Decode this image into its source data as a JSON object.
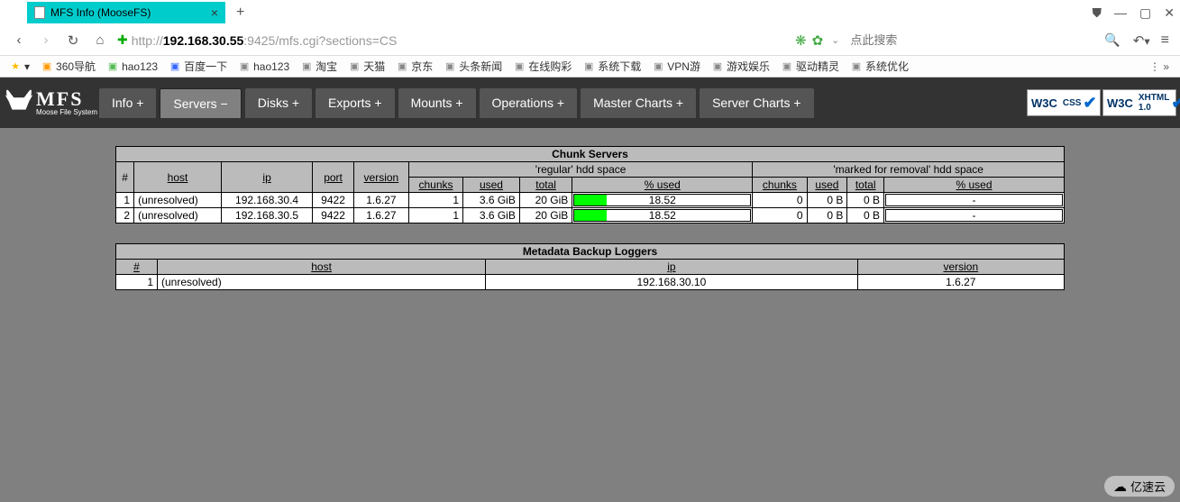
{
  "browser": {
    "tab_title": "MFS Info (MooseFS)",
    "url_prefix": "http://",
    "url_host": "192.168.30.55",
    "url_rest": ":9425/mfs.cgi?sections=CS",
    "search_placeholder": "点此搜索"
  },
  "bookmarks": [
    {
      "label": "360导航",
      "color": "#f90"
    },
    {
      "label": "hao123",
      "color": "#5b5"
    },
    {
      "label": "百度一下",
      "color": "#36f"
    },
    {
      "label": "hao123",
      "color": "#888"
    },
    {
      "label": "淘宝",
      "color": "#888"
    },
    {
      "label": "天猫",
      "color": "#888"
    },
    {
      "label": "京东",
      "color": "#888"
    },
    {
      "label": "头条新闻",
      "color": "#888"
    },
    {
      "label": "在线购彩",
      "color": "#888"
    },
    {
      "label": "系统下载",
      "color": "#888"
    },
    {
      "label": "VPN游",
      "color": "#888"
    },
    {
      "label": "游戏娱乐",
      "color": "#888"
    },
    {
      "label": "驱动精灵",
      "color": "#888"
    },
    {
      "label": "系统优化",
      "color": "#888"
    }
  ],
  "logo": {
    "main": "MFS",
    "sub": "Moose File System"
  },
  "nav": [
    {
      "label": "Info +",
      "active": false
    },
    {
      "label": "Servers −",
      "active": true
    },
    {
      "label": "Disks +",
      "active": false
    },
    {
      "label": "Exports +",
      "active": false
    },
    {
      "label": "Mounts +",
      "active": false
    },
    {
      "label": "Operations +",
      "active": false
    },
    {
      "label": "Master Charts +",
      "active": false
    },
    {
      "label": "Server Charts +",
      "active": false
    }
  ],
  "chunk": {
    "title": "Chunk Servers",
    "group_reg": "'regular' hdd space",
    "group_mfr": "'marked for removal' hdd space",
    "cols": {
      "num": "#",
      "host": "host",
      "ip": "ip",
      "port": "port",
      "version": "version",
      "chunks": "chunks",
      "used": "used",
      "total": "total",
      "pused": "% used"
    },
    "rows": [
      {
        "num": "1",
        "host": "(unresolved)",
        "ip": "192.168.30.4",
        "port": "9422",
        "version": "1.6.27",
        "r_chunks": "1",
        "r_used": "3.6 GiB",
        "r_total": "20 GiB",
        "r_pused": "18.52",
        "m_chunks": "0",
        "m_used": "0 B",
        "m_total": "0 B",
        "m_pused": "-"
      },
      {
        "num": "2",
        "host": "(unresolved)",
        "ip": "192.168.30.5",
        "port": "9422",
        "version": "1.6.27",
        "r_chunks": "1",
        "r_used": "3.6 GiB",
        "r_total": "20 GiB",
        "r_pused": "18.52",
        "m_chunks": "0",
        "m_used": "0 B",
        "m_total": "0 B",
        "m_pused": "-"
      }
    ]
  },
  "meta": {
    "title": "Metadata Backup Loggers",
    "cols": {
      "num": "#",
      "host": "host",
      "ip": "ip",
      "version": "version"
    },
    "rows": [
      {
        "num": "1",
        "host": "(unresolved)",
        "ip": "192.168.30.10",
        "version": "1.6.27"
      }
    ]
  },
  "w3c": {
    "css": "CSS",
    "xhtml": "XHTML",
    "ver": "1.0",
    "w3c": "W3C"
  },
  "watermark": "亿速云"
}
